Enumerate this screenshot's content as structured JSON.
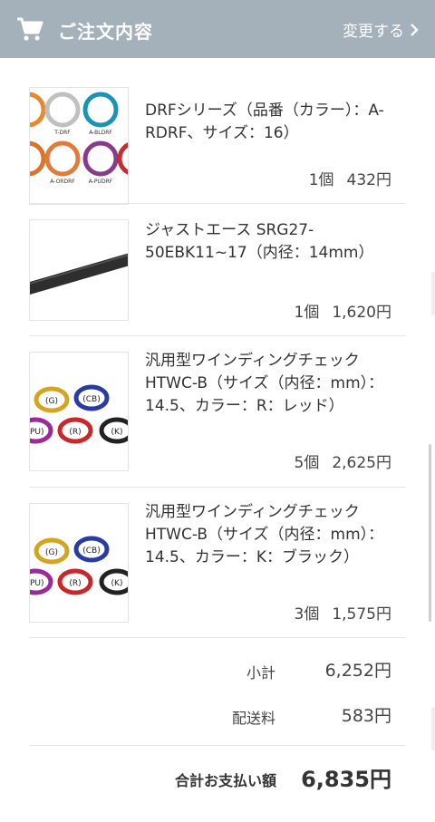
{
  "header": {
    "title": "ご注文内容",
    "change_label": "変更する",
    "background": "#a4b1bb"
  },
  "items": [
    {
      "name": "DRFシリーズ（品番（カラー）：A-RDRF、サイズ：16）",
      "qty": "1個",
      "price": "432円",
      "thumb_labels": [
        "T-DRF",
        "A-BLDRF",
        "A-ORDRF",
        "A-PUDRF"
      ]
    },
    {
      "name": "ジャストエース SRG27-50EBK11~17（内径：14mm）",
      "qty": "1個",
      "price": "1,620円"
    },
    {
      "name": "汎用型ワインディングチェック HTWC-B（サイズ（内径：mm）：14.5、カラー：R：レッド）",
      "qty": "5個",
      "price": "2,625円",
      "thumb_labels": [
        "(G)",
        "(CB)",
        "(PU)",
        "(R)",
        "(K)"
      ]
    },
    {
      "name": "汎用型ワインディングチェック HTWC-B（サイズ（内径：mm）：14.5、カラー：K：ブラック）",
      "qty": "3個",
      "price": "1,575円",
      "thumb_labels": [
        "(G)",
        "(CB)",
        "(PU)",
        "(R)",
        "(K)"
      ]
    }
  ],
  "summary": {
    "subtotal_label": "小計",
    "subtotal_value": "6,252円",
    "shipping_label": "配送料",
    "shipping_value": "583円",
    "total_label": "合計お支払い額",
    "total_value": "6,835円"
  }
}
